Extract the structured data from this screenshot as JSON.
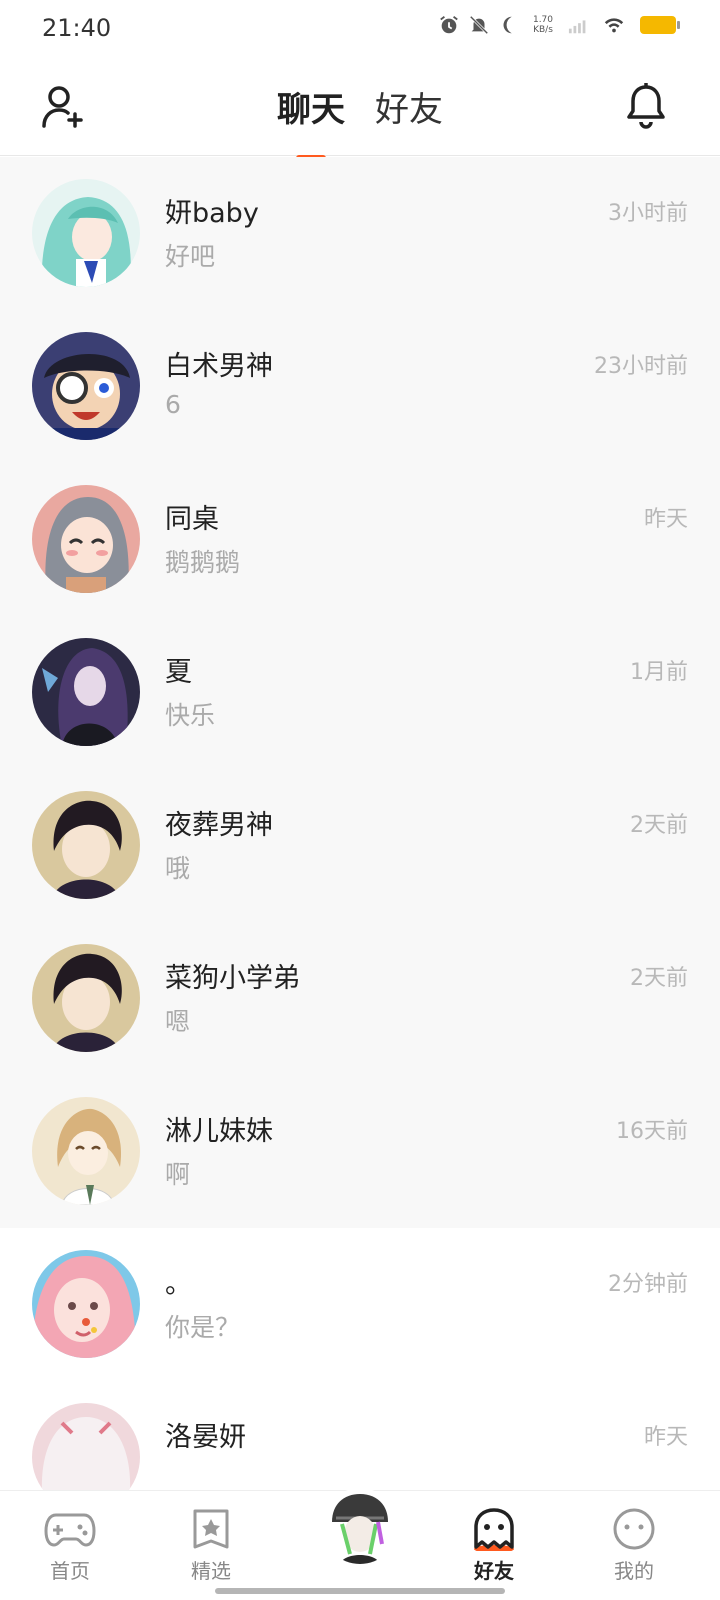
{
  "status_bar": {
    "time": "21:40",
    "net_speed_value": "1.70",
    "net_speed_unit": "KB/s"
  },
  "header": {
    "tabs": [
      {
        "label": "聊天",
        "active": true
      },
      {
        "label": "好友",
        "active": false
      }
    ],
    "add_friend_icon": "add-user-icon",
    "notification_icon": "bell-icon"
  },
  "chats": [
    {
      "name": "妍baby",
      "message": "好吧",
      "time": "3小时前",
      "avatar_color": "#7fd3c8"
    },
    {
      "name": "白术男神",
      "message": "6",
      "time": "23小时前",
      "avatar_color": "#3b3f73"
    },
    {
      "name": "同桌",
      "message": "鹅鹅鹅",
      "time": "昨天",
      "avatar_color": "#e9a8a0"
    },
    {
      "name": "夏",
      "message": "快乐",
      "time": "1月前",
      "avatar_color": "#2c2a44"
    },
    {
      "name": "夜葬男神",
      "message": "哦",
      "time": "2天前",
      "avatar_color": "#d9c89e"
    },
    {
      "name": "菜狗小学弟",
      "message": "嗯",
      "time": "2天前",
      "avatar_color": "#d9c89e"
    },
    {
      "name": "淋儿妹妹",
      "message": "啊",
      "time": "16天前",
      "avatar_color": "#f1e6cf"
    },
    {
      "name": "。",
      "message": "你是？",
      "time": "2分钟前",
      "avatar_color": "#f3a6b4"
    },
    {
      "name": "洛晏妍",
      "message": "",
      "time": "昨天",
      "avatar_color": "#f0d8dc"
    }
  ],
  "bottom_nav": [
    {
      "label": "首页",
      "icon": "gamepad-icon",
      "active": false
    },
    {
      "label": "精选",
      "icon": "star-badge-icon",
      "active": false
    },
    {
      "label": "好友",
      "icon": "ghost-icon",
      "active": true
    },
    {
      "label": "我的",
      "icon": "smiley-icon",
      "active": false
    }
  ],
  "colors": {
    "accent": "#ff5a1f",
    "list_bg": "#f8f8f8",
    "muted_text": "#aaaaaa"
  }
}
